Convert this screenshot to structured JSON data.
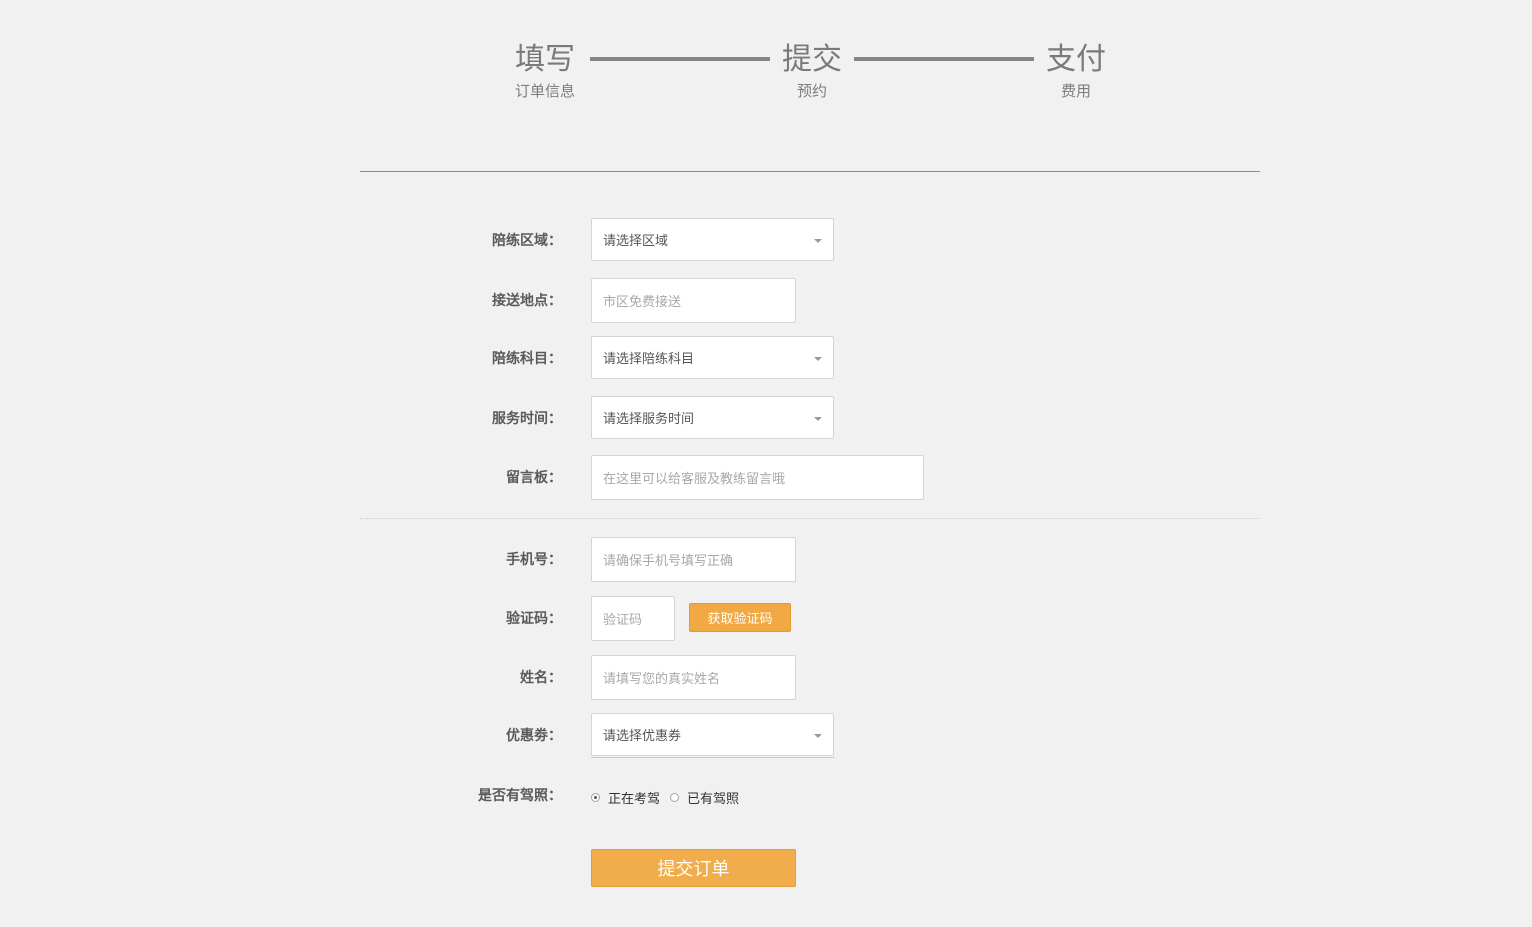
{
  "steps": [
    {
      "title": "填写",
      "subtitle": "订单信息"
    },
    {
      "title": "提交",
      "subtitle": "预约"
    },
    {
      "title": "支付",
      "subtitle": "费用"
    }
  ],
  "form": {
    "area": {
      "label": "陪练区域：",
      "value": "请选择区域"
    },
    "pickup": {
      "label": "接送地点：",
      "placeholder": "市区免费接送"
    },
    "subject": {
      "label": "陪练科目：",
      "value": "请选择陪练科目"
    },
    "time": {
      "label": "服务时间：",
      "value": "请选择服务时间"
    },
    "message": {
      "label": "留言板：",
      "placeholder": "在这里可以给客服及教练留言哦"
    },
    "phone": {
      "label": "手机号：",
      "placeholder": "请确保手机号填写正确"
    },
    "code": {
      "label": "验证码：",
      "placeholder": "验证码",
      "button": "获取验证码"
    },
    "name": {
      "label": "姓名：",
      "placeholder": "请填写您的真实姓名"
    },
    "coupon": {
      "label": "优惠劵：",
      "value": "请选择优惠券"
    },
    "license": {
      "label": "是否有驾照：",
      "options": [
        {
          "label": "正在考驾",
          "checked": true
        },
        {
          "label": "已有驾照",
          "checked": false
        }
      ]
    },
    "submit": "提交订单"
  },
  "colors": {
    "accent": "#f1ac4b",
    "background": "#f1f1f1"
  }
}
